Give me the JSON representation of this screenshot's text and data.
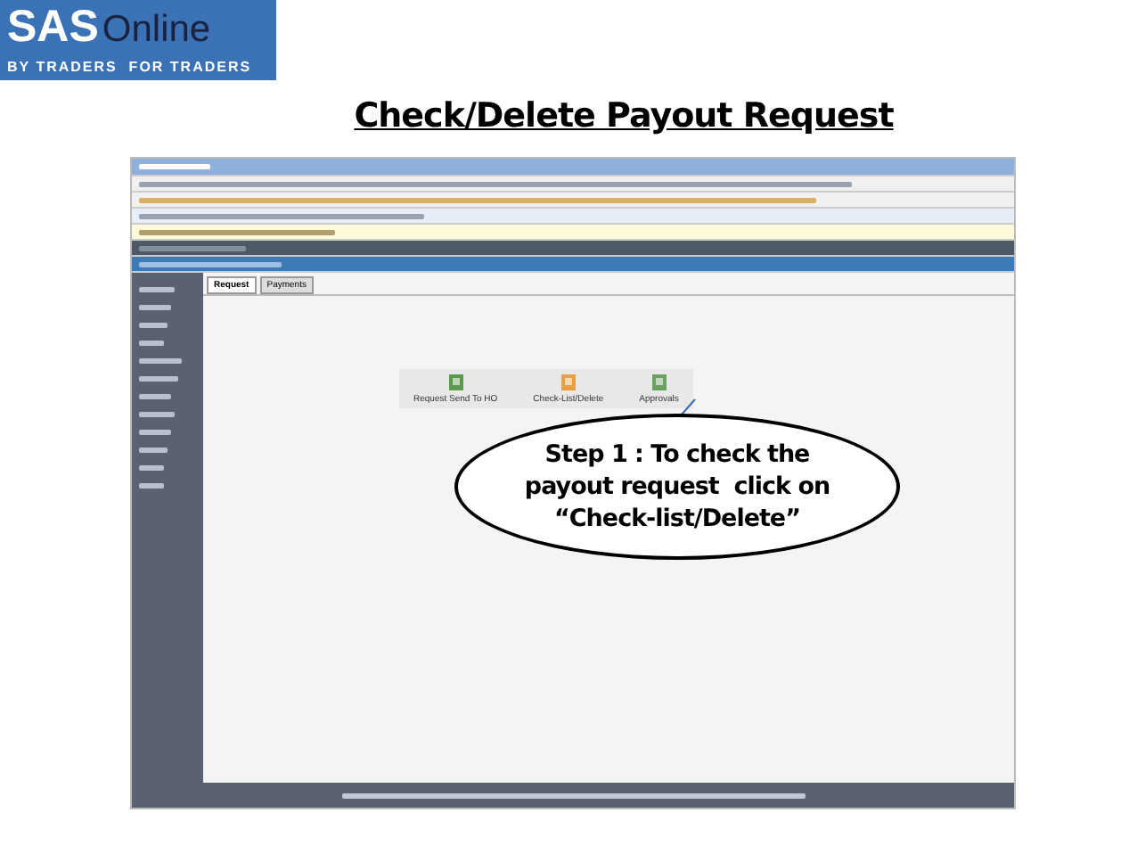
{
  "logo": {
    "brand": "SAS",
    "suffix": "Online",
    "tagline": "BY TRADERS  FOR TRADERS"
  },
  "title": "Check/Delete Payout Request",
  "screenshot": {
    "tabs": [
      {
        "label": "Request",
        "selected": true
      },
      {
        "label": "Payments",
        "selected": false
      }
    ],
    "tiles": [
      {
        "label": "Request Send To HO",
        "kind": "send"
      },
      {
        "label": "Check-List/Delete",
        "kind": "check"
      },
      {
        "label": "Approvals",
        "kind": "approve"
      }
    ]
  },
  "callout": {
    "lines": [
      "Step 1 : To check the",
      "payout request  click on",
      "“Check-list/Delete”"
    ]
  }
}
